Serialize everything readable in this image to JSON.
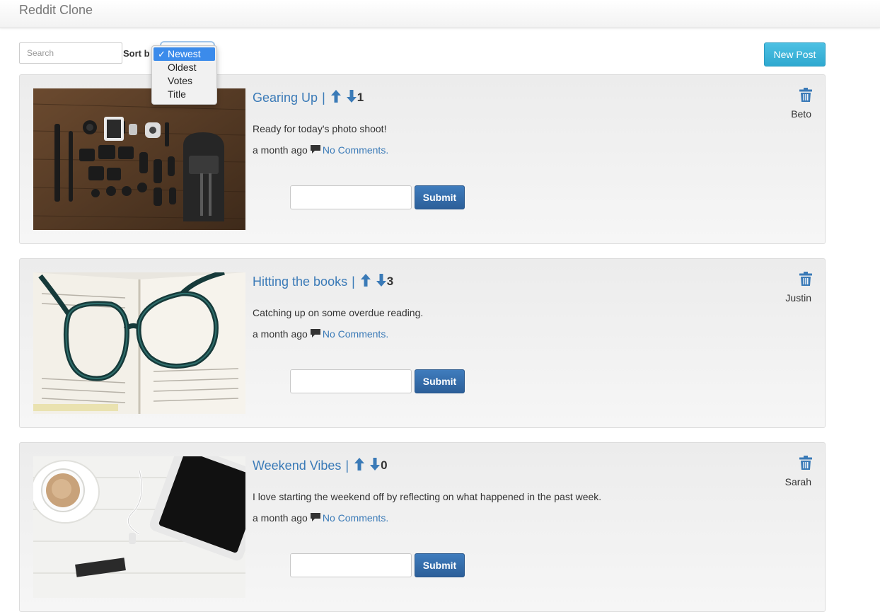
{
  "app": {
    "title": "Reddit Clone"
  },
  "toolbar": {
    "search_placeholder": "Search",
    "sort_label": "Sort b",
    "sort_options": [
      "Newest",
      "Oldest",
      "Votes",
      "Title"
    ],
    "sort_selected": "Newest",
    "new_post_label": "New Post"
  },
  "colors": {
    "link": "#3a7ab7",
    "primary": "#2c5f99",
    "info": "#2fa9d0",
    "highlight": "#3b8beb"
  },
  "posts": [
    {
      "title": "Gearing Up",
      "separator": "|",
      "votes": "1",
      "text": "Ready for today's photo shoot!",
      "time": "a month ago",
      "comments_label": "No Comments.",
      "author": "Beto",
      "submit_label": "Submit",
      "image": "camera-gear-flatlay"
    },
    {
      "title": "Hitting the books",
      "separator": "|",
      "votes": "3",
      "text": "Catching up on some overdue reading.",
      "time": "a month ago",
      "comments_label": "No Comments.",
      "author": "Justin",
      "submit_label": "Submit",
      "image": "glasses-on-book"
    },
    {
      "title": "Weekend Vibes",
      "separator": "|",
      "votes": "0",
      "text": "I love starting the weekend off by reflecting on what happened in the past week.",
      "time": "a month ago",
      "comments_label": "No Comments.",
      "author": "Sarah",
      "submit_label": "Submit",
      "image": "coffee-and-tablet"
    }
  ]
}
